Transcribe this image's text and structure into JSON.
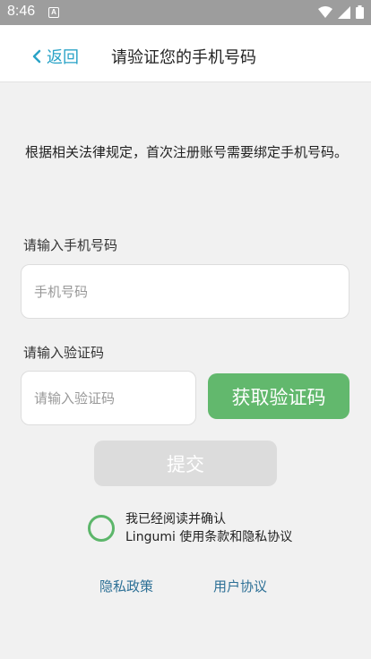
{
  "status_bar": {
    "time": "8:46",
    "notification_icon": "a-box-icon",
    "icons": [
      "wifi-icon",
      "signal-icon",
      "battery-icon"
    ]
  },
  "navbar": {
    "back_label": "返回",
    "title": "请验证您的手机号码"
  },
  "notice": "根据相关法律规定，首次注册账号需要绑定手机号码。",
  "phone": {
    "label": "请输入手机号码",
    "placeholder": "手机号码",
    "value": ""
  },
  "code": {
    "label": "请输入验证码",
    "placeholder": "请输入验证码",
    "value": ""
  },
  "buttons": {
    "get_code": "获取验证码",
    "submit": "提交"
  },
  "agreement": {
    "line1": "我已经阅读并确认",
    "line2": "Lingumi 使用条款和隐私协议",
    "checked": false
  },
  "links": {
    "privacy": "隐私政策",
    "user_agreement": "用户协议"
  },
  "colors": {
    "accent_green": "#62b86d",
    "back_blue": "#2aa3c7",
    "link_blue": "#2d7096",
    "disabled_gray": "#dcdcdc"
  }
}
